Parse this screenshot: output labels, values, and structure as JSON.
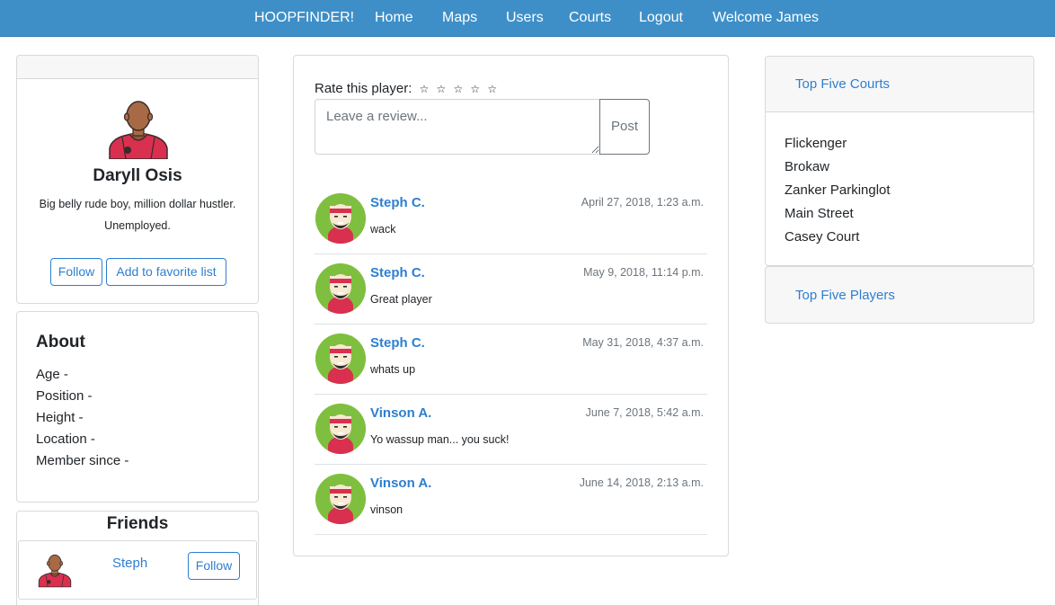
{
  "nav": {
    "brand": "HOOPFINDER!",
    "items": [
      "Home",
      "Maps",
      "Users",
      "Courts",
      "Logout"
    ],
    "welcome": "Welcome James"
  },
  "profile": {
    "name": "Daryll Osis",
    "bio": "Big belly rude boy, million dollar hustler. Unemployed.",
    "follow_label": "Follow",
    "favorite_label": "Add to favorite list"
  },
  "about": {
    "title": "About",
    "fields": [
      "Age -",
      "Position -",
      "Height -",
      "Location -",
      "Member since -"
    ]
  },
  "friends": {
    "title": "Friends",
    "items": [
      {
        "name": "Steph",
        "follow_label": "Follow"
      }
    ]
  },
  "rating": {
    "label": "Rate this player:",
    "stars": [
      "☆",
      "☆",
      "☆",
      "☆",
      "☆"
    ]
  },
  "review_form": {
    "placeholder": "Leave a review...",
    "post_label": "Post"
  },
  "reviews": [
    {
      "author": "Steph C.",
      "date": "April 27, 2018, 1:23 a.m.",
      "text": "wack"
    },
    {
      "author": "Steph C.",
      "date": "May 9, 2018, 11:14 p.m.",
      "text": "Great player"
    },
    {
      "author": "Steph C.",
      "date": "May 31, 2018, 4:37 a.m.",
      "text": "whats up"
    },
    {
      "author": "Vinson A.",
      "date": "June 7, 2018, 5:42 a.m.",
      "text": "Yo wassup man... you suck!"
    },
    {
      "author": "Vinson A.",
      "date": "June 14, 2018, 2:13 a.m.",
      "text": "vinson"
    }
  ],
  "top_courts": {
    "title": "Top Five Courts",
    "items": [
      "Flickenger",
      "Brokaw",
      "Zanker Parkinglot",
      "Main Street",
      "Casey Court"
    ]
  },
  "top_players": {
    "title": "Top Five Players"
  },
  "colors": {
    "navbar": "#3e8fc8",
    "link": "#2d7fd1",
    "avatar_bg": "#7fbf3f",
    "jersey": "#d9304f"
  }
}
